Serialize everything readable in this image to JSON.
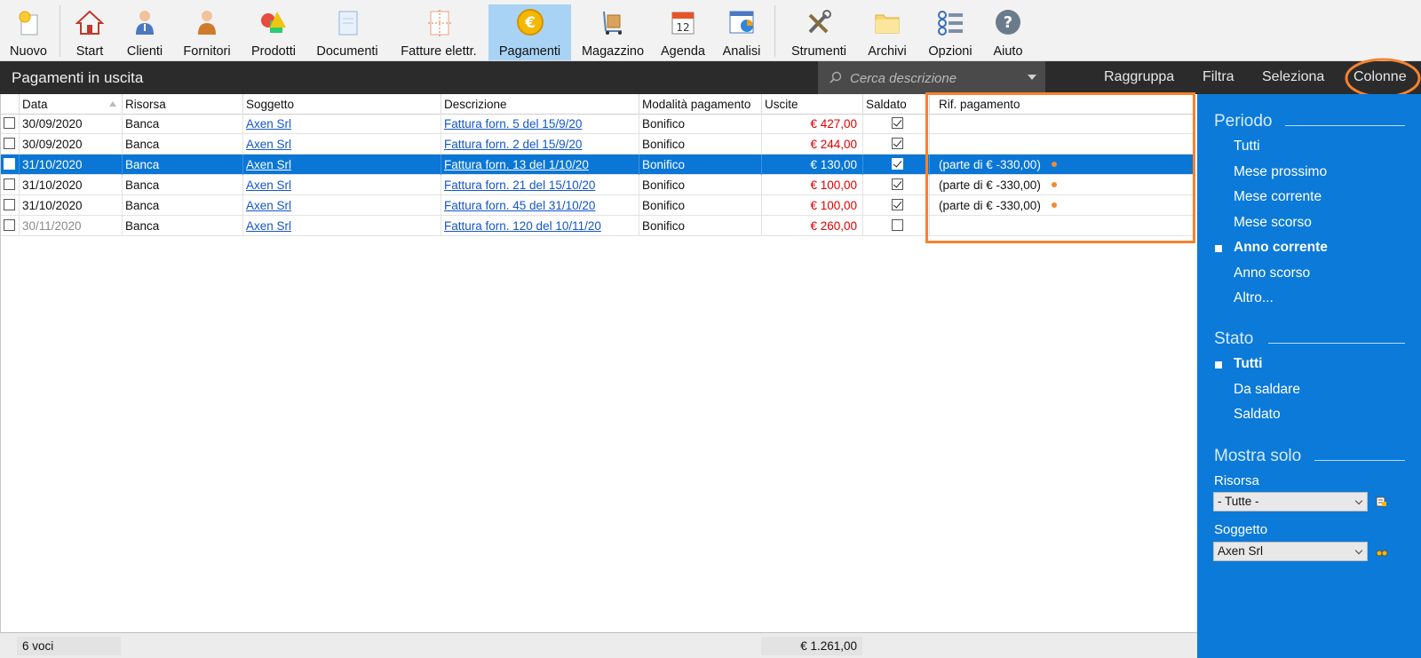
{
  "toolbar": {
    "buttons": [
      {
        "label": "Nuovo",
        "icon": "new-icon"
      },
      {
        "label": "Start",
        "icon": "home-icon"
      },
      {
        "label": "Clienti",
        "icon": "client-icon"
      },
      {
        "label": "Fornitori",
        "icon": "supplier-icon"
      },
      {
        "label": "Prodotti",
        "icon": "products-icon"
      },
      {
        "label": "Documenti",
        "icon": "documents-icon"
      },
      {
        "label": "Fatture elettr.",
        "icon": "einvoice-icon"
      },
      {
        "label": "Pagamenti",
        "icon": "euro-icon",
        "active": true
      },
      {
        "label": "Magazzino",
        "icon": "warehouse-icon"
      },
      {
        "label": "Agenda",
        "icon": "calendar-icon"
      },
      {
        "label": "Analisi",
        "icon": "analysis-icon"
      },
      {
        "label": "Strumenti",
        "icon": "tools-icon"
      },
      {
        "label": "Archivi",
        "icon": "folder-icon"
      },
      {
        "label": "Opzioni",
        "icon": "options-icon"
      },
      {
        "label": "Aiuto",
        "icon": "help-icon"
      }
    ]
  },
  "titlebar": {
    "title": "Pagamenti in uscita",
    "search_placeholder": "Cerca descrizione",
    "actions": [
      "Raggruppa",
      "Filtra",
      "Seleziona",
      "Colonne"
    ]
  },
  "table": {
    "columns": [
      "Data",
      "Risorsa",
      "Soggetto",
      "Descrizione",
      "Modalità pagamento",
      "Uscite",
      "Saldato",
      "Rif. pagamento"
    ],
    "rows": [
      {
        "data": "30/09/2020",
        "risorsa": "Banca",
        "soggetto": "Axen Srl",
        "descrizione": "Fattura forn. 5 del 15/9/20",
        "modalita": "Bonifico",
        "uscite": "€ 427,00",
        "saldato": true,
        "rif": "",
        "selected": false,
        "muted": false
      },
      {
        "data": "30/09/2020",
        "risorsa": "Banca",
        "soggetto": "Axen Srl",
        "descrizione": "Fattura forn. 2 del 15/9/20",
        "modalita": "Bonifico",
        "uscite": "€ 244,00",
        "saldato": true,
        "rif": "",
        "selected": false,
        "muted": false
      },
      {
        "data": "31/10/2020",
        "risorsa": "Banca",
        "soggetto": "Axen Srl",
        "descrizione": "Fattura forn. 13 del 1/10/20",
        "modalita": "Bonifico",
        "uscite": "€ 130,00",
        "saldato": true,
        "rif": "(parte di € -330,00)",
        "selected": true,
        "muted": false
      },
      {
        "data": "31/10/2020",
        "risorsa": "Banca",
        "soggetto": "Axen Srl",
        "descrizione": "Fattura forn. 21 del 15/10/20",
        "modalita": "Bonifico",
        "uscite": "€ 100,00",
        "saldato": true,
        "rif": "(parte di € -330,00)",
        "selected": false,
        "muted": false
      },
      {
        "data": "31/10/2020",
        "risorsa": "Banca",
        "soggetto": "Axen Srl",
        "descrizione": "Fattura forn. 45 del 31/10/20",
        "modalita": "Bonifico",
        "uscite": "€ 100,00",
        "saldato": true,
        "rif": "(parte di € -330,00)",
        "selected": false,
        "muted": false
      },
      {
        "data": "30/11/2020",
        "risorsa": "Banca",
        "soggetto": "Axen Srl",
        "descrizione": "Fattura forn. 120 del 10/11/20",
        "modalita": "Bonifico",
        "uscite": "€ 260,00",
        "saldato": false,
        "rif": "",
        "selected": false,
        "muted": true
      }
    ]
  },
  "footer": {
    "count": "6 voci",
    "total": "€ 1.261,00"
  },
  "side": {
    "periodo": {
      "title": "Periodo",
      "options": [
        "Tutti",
        "Mese prossimo",
        "Mese corrente",
        "Mese scorso",
        "Anno corrente",
        "Anno scorso",
        "Altro..."
      ],
      "selected": "Anno corrente"
    },
    "stato": {
      "title": "Stato",
      "options": [
        "Tutti",
        "Da saldare",
        "Saldato"
      ],
      "selected": "Tutti"
    },
    "mostra": {
      "title": "Mostra solo",
      "risorsa_label": "Risorsa",
      "risorsa_value": "- Tutte -",
      "soggetto_label": "Soggetto",
      "soggetto_value": "Axen Srl"
    }
  },
  "colors": {
    "accent": "#0b7ad9",
    "selection": "#0a76d6",
    "highlight": "#f7822f",
    "negative": "#e00000"
  }
}
